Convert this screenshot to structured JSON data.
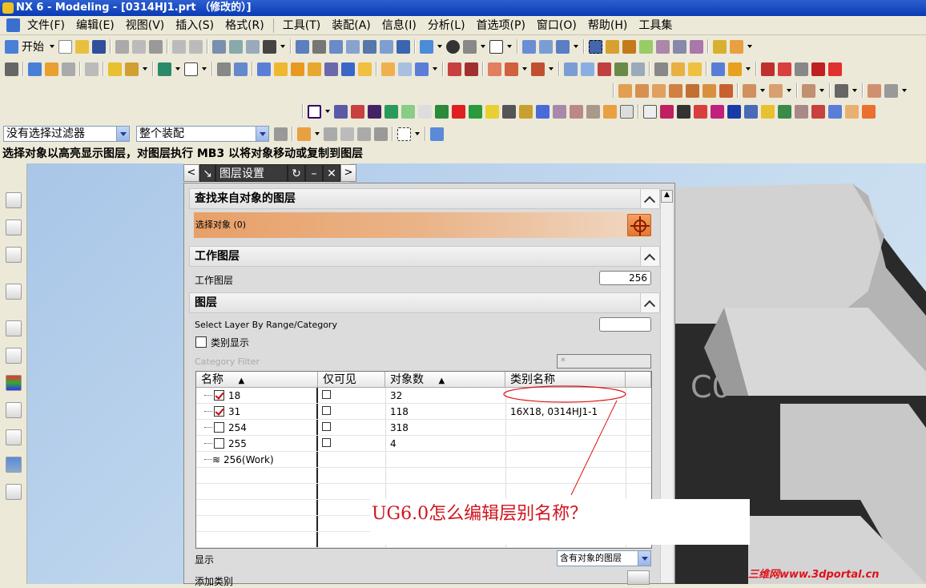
{
  "titlebar": {
    "title": "NX 6 - Modeling - [0314HJ1.prt （修改的）]"
  },
  "menubar": {
    "items": [
      "文件(F)",
      "编辑(E)",
      "视图(V)",
      "插入(S)",
      "格式(R)",
      "工具(T)",
      "装配(A)",
      "信息(I)",
      "分析(L)",
      "首选项(P)",
      "窗口(O)",
      "帮助(H)",
      "工具集"
    ]
  },
  "toolbar": {
    "start_label": "开始"
  },
  "selection": {
    "filter": "没有选择过滤器",
    "scope": "整个装配"
  },
  "cue": "选择对象以高亮显示图层，对图层执行 MB3 以将对象移动或复制到图层",
  "dialog": {
    "tab_title": "图层设置",
    "sections": {
      "find": "查找来自对象的图层",
      "work": "工作图层",
      "layers": "图层"
    },
    "select_object": "选择对象 (0)",
    "work_layer_label": "工作图层",
    "work_layer_value": "256",
    "select_by_range": "Select Layer By Range/Category",
    "category_display": "类别显示",
    "category_filter_label": "Category Filter",
    "category_filter_value": "*",
    "table": {
      "headers": {
        "name": "名称",
        "visible_only": "仅可见",
        "object_count": "对象数",
        "category_name": "类别名称"
      },
      "rows": [
        {
          "name": "18",
          "checked": true,
          "count": "32",
          "category": ""
        },
        {
          "name": "31",
          "checked": true,
          "count": "118",
          "category": "16X18, 0314HJ1-1"
        },
        {
          "name": "254",
          "checked": false,
          "count": "318",
          "category": ""
        },
        {
          "name": "255",
          "checked": false,
          "count": "4",
          "category": ""
        },
        {
          "name": "256(Work)",
          "checked": null,
          "count": "",
          "category": ""
        }
      ]
    },
    "display_label": "显示",
    "display_value": "含有对象的图层",
    "add_category": "添加类别"
  },
  "annotation": "UG6.0怎么编辑层别名称？",
  "watermark": "三维网www.3dportal.cn",
  "colors": {
    "accent_red": "#d0141e",
    "title_blue": "#0a3bb5",
    "select_orange": "#e8a068"
  }
}
